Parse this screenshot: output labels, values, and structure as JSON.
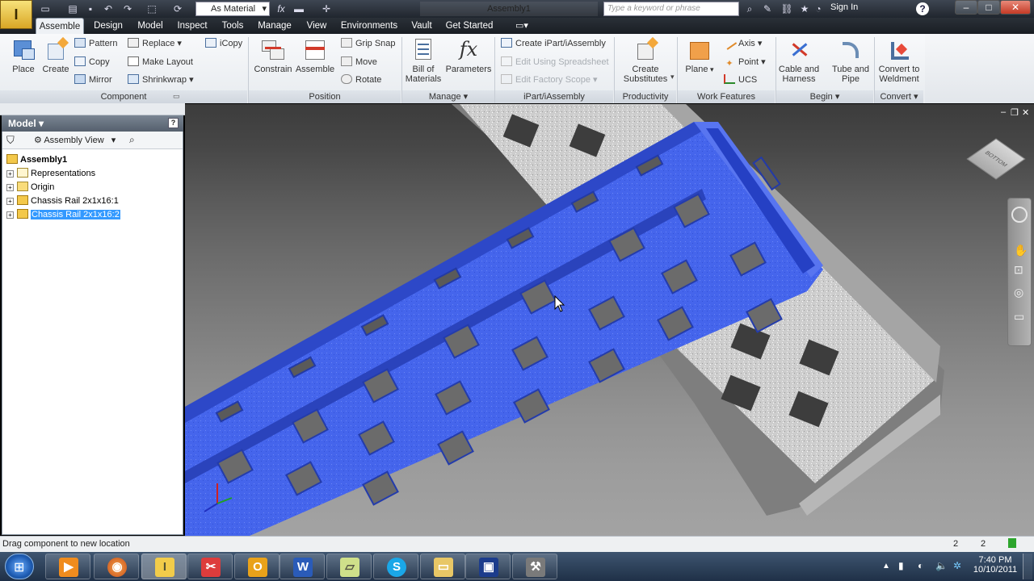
{
  "window": {
    "title": "Assembly1"
  },
  "quick_access": {
    "material": "As Material",
    "search_placeholder": "Type a keyword or phrase",
    "sign_in": "Sign In"
  },
  "tabs": [
    {
      "label": "Assemble",
      "active": true
    },
    {
      "label": "Design"
    },
    {
      "label": "Model"
    },
    {
      "label": "Inspect"
    },
    {
      "label": "Tools"
    },
    {
      "label": "Manage"
    },
    {
      "label": "View"
    },
    {
      "label": "Environments"
    },
    {
      "label": "Vault"
    },
    {
      "label": "Get Started"
    }
  ],
  "ribbon": {
    "component": {
      "label": "Component",
      "place": "Place",
      "create": "Create",
      "pattern": "Pattern",
      "copy": "Copy",
      "mirror": "Mirror",
      "replace": "Replace",
      "make_layout": "Make Layout",
      "shrinkwrap": "Shrinkwrap",
      "icopy": "iCopy"
    },
    "position": {
      "label": "Position",
      "constrain": "Constrain",
      "assemble": "Assemble",
      "grip_snap": "Grip Snap",
      "move": "Move",
      "rotate": "Rotate"
    },
    "manage": {
      "label": "Manage",
      "bom_l1": "Bill of",
      "bom_l2": "Materials",
      "parameters": "Parameters"
    },
    "ipart": {
      "label": "iPart/iAssembly",
      "create": "Create iPart/iAssembly",
      "edit_sheet": "Edit Using Spreadsheet",
      "edit_factory": "Edit Factory Scope"
    },
    "productivity": {
      "label": "Productivity",
      "l1": "Create",
      "l2": "Substitutes"
    },
    "work_features": {
      "label": "Work Features",
      "plane": "Plane",
      "axis": "Axis",
      "point": "Point",
      "ucs": "UCS"
    },
    "begin": {
      "label": "Begin",
      "cable_l1": "Cable and",
      "cable_l2": "Harness",
      "tube_l1": "Tube and",
      "tube_l2": "Pipe"
    },
    "convert": {
      "label": "Convert",
      "l1": "Convert to",
      "l2": "Weldment"
    }
  },
  "browser": {
    "title": "Model",
    "view": "Assembly View",
    "root": "Assembly1",
    "items": [
      {
        "label": "Representations"
      },
      {
        "label": "Origin"
      },
      {
        "label": "Chassis Rail 2x1x16:1"
      },
      {
        "label": "Chassis Rail 2x1x16:2",
        "selected": true
      }
    ]
  },
  "viewcube": {
    "face": "BOTTOM"
  },
  "status": {
    "text": "Drag component to new location",
    "count_a": "2",
    "count_b": "2"
  },
  "taskbar": {
    "time": "7:40 PM",
    "date": "10/10/2011"
  },
  "colors": {
    "selected_part": "#3a5ff0",
    "other_part": "#c8c8c8",
    "accent": "#3399ff"
  }
}
